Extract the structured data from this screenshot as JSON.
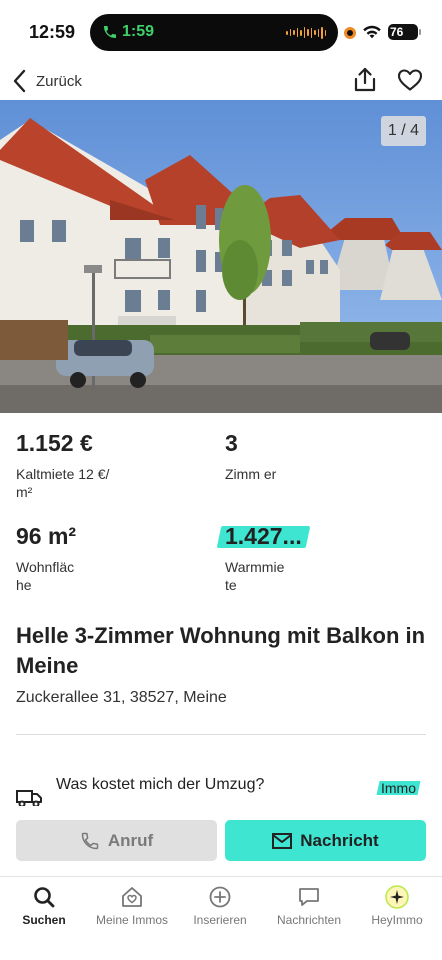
{
  "status_bar": {
    "time": "12:59",
    "call_timer": "1:59",
    "battery": "76"
  },
  "header": {
    "back_label": "Zurück",
    "share_icon": "share-icon",
    "favorite_icon": "heart-icon"
  },
  "gallery": {
    "counter": "1 / 4"
  },
  "facts": [
    {
      "value": "1.152 €",
      "label": "Kaltmiete 12 €/ m²"
    },
    {
      "value": "3",
      "label": "Zimm er"
    },
    {
      "value": "96 m²",
      "label": "Wohnfläc he"
    },
    {
      "value": "1.427...",
      "label": "Warmmie te"
    }
  ],
  "listing": {
    "title": "Helle 3-Zimmer Wohnung mit Balkon in Meine",
    "address": "Zuckerallee 31, 38527, Meine"
  },
  "moving": {
    "title": "Was kostet mich der Umzug?",
    "badge": "Immo"
  },
  "actions": {
    "call_label": "Anruf",
    "message_label": "Nachricht"
  },
  "tabs": [
    {
      "label": "Suchen",
      "icon": "search-icon"
    },
    {
      "label": "Meine Immos",
      "icon": "home-heart-icon"
    },
    {
      "label": "Inserieren",
      "icon": "plus-circle-icon"
    },
    {
      "label": "Nachrichten",
      "icon": "chat-icon"
    },
    {
      "label": "HeyImmo",
      "icon": "sparkle-icon"
    }
  ],
  "colors": {
    "accent": "#3ee6d2",
    "call_green": "#3fd06a"
  }
}
